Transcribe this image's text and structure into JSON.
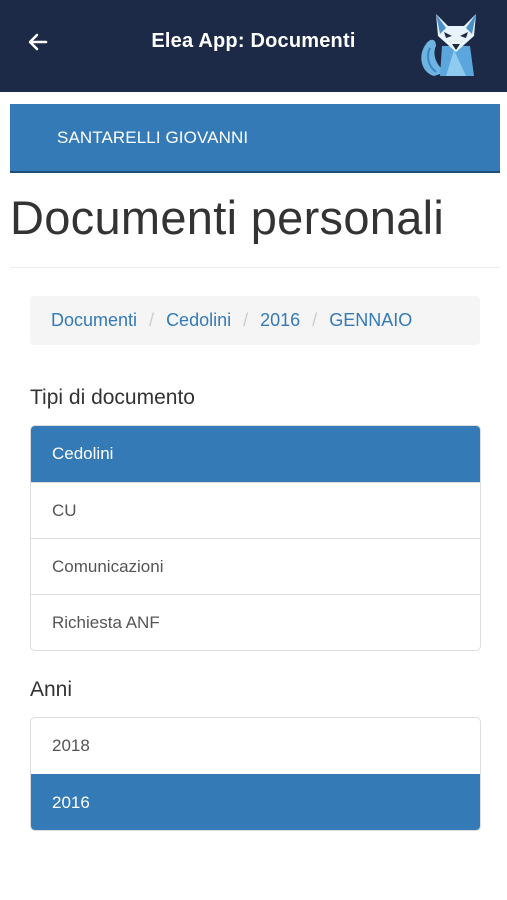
{
  "header": {
    "title": "Elea App: Documenti",
    "back_icon": "arrow-left-icon",
    "logo": "fox-logo"
  },
  "user": {
    "name": "SANTARELLI GIOVANNI"
  },
  "page": {
    "title": "Documenti personali"
  },
  "breadcrumb": [
    "Documenti",
    "Cedolini",
    "2016",
    "GENNAIO"
  ],
  "doc_types": {
    "heading": "Tipi di documento",
    "items": [
      {
        "label": "Cedolini",
        "active": true
      },
      {
        "label": "CU",
        "active": false
      },
      {
        "label": "Comunicazioni",
        "active": false
      },
      {
        "label": "Richiesta ANF",
        "active": false
      }
    ]
  },
  "years": {
    "heading": "Anni",
    "items": [
      {
        "label": "2018",
        "active": false
      },
      {
        "label": "2016",
        "active": true
      }
    ]
  },
  "colors": {
    "header_bg": "#1c2a48",
    "accent": "#337ab7",
    "breadcrumb_bg": "#f5f5f5"
  }
}
